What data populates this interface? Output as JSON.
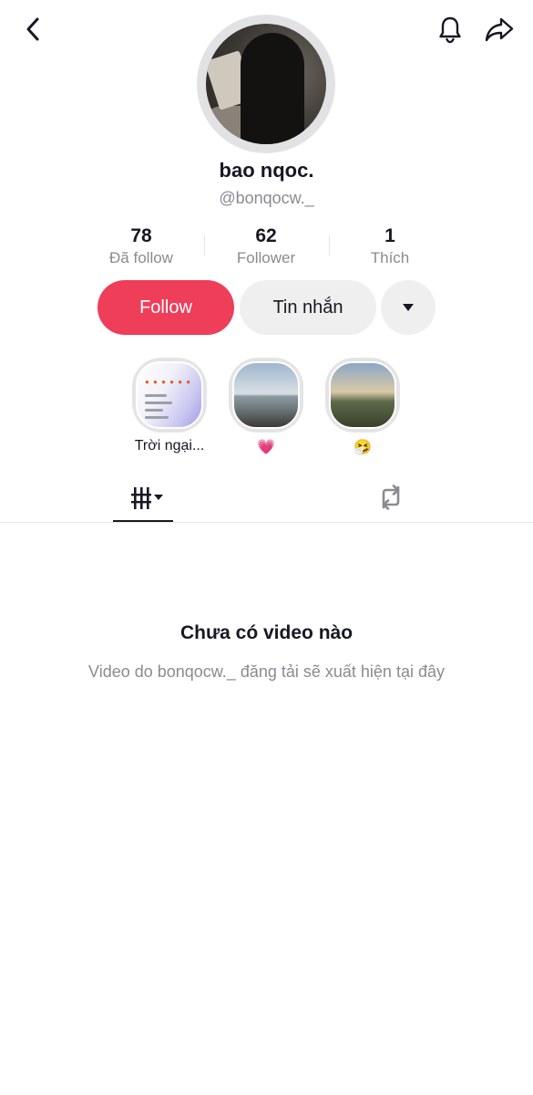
{
  "profile": {
    "display_name": "bao nqoc.",
    "username": "@bonqocw._"
  },
  "stats": [
    {
      "value": "78",
      "label": "Đã follow"
    },
    {
      "value": "62",
      "label": "Follower"
    },
    {
      "value": "1",
      "label": "Thích"
    }
  ],
  "actions": {
    "follow_label": "Follow",
    "message_label": "Tin nhắn"
  },
  "highlights": [
    {
      "caption": "Trời ngại..."
    },
    {
      "caption": "💗"
    },
    {
      "caption": "🤧"
    }
  ],
  "empty_state": {
    "title": "Chưa có video nào",
    "subtitle": "Video do bonqocw._ đăng tải sẽ xuất hiện tại đây"
  },
  "icons": {
    "back": "chevron-left-icon",
    "notifications": "bell-icon",
    "share": "share-arrow-icon",
    "more": "caret-down-icon",
    "videos_tab": "video-grid-icon",
    "reposts_tab": "repost-icon"
  },
  "colors": {
    "follow_button": "#ee3e5a",
    "secondary_button": "#efefef",
    "text_primary": "#161823",
    "text_secondary": "#8a8b91"
  }
}
